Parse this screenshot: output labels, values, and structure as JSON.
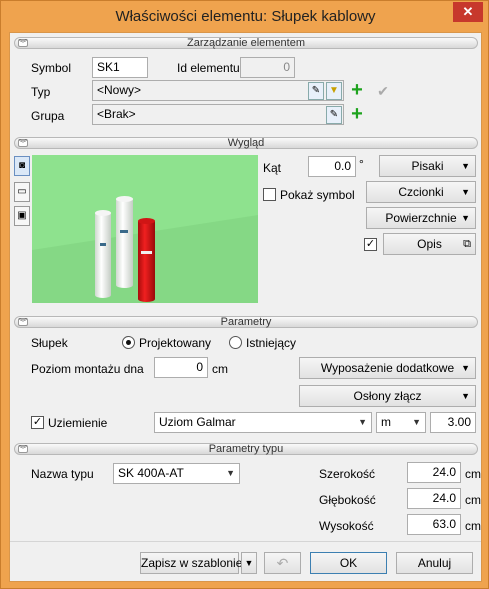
{
  "window": {
    "title": "Właściwości elementu: Słupek kablowy",
    "close_label": "✕"
  },
  "sections": {
    "management": "Zarządzanie elementem",
    "appearance": "Wygląd",
    "parameters": "Parametry",
    "type_parameters": "Parametry typu"
  },
  "management": {
    "symbol_label": "Symbol",
    "symbol_value": "SK1",
    "id_label": "Id elementu",
    "id_value": "0",
    "type_label": "Typ",
    "type_value": "<Nowy>",
    "group_label": "Grupa",
    "group_value": "<Brak>"
  },
  "appearance": {
    "angle_label": "Kąt",
    "angle_value": "0.0",
    "angle_unit": "°",
    "show_symbol_label": "Pokaż symbol",
    "show_symbol_checked": false,
    "pens_button": "Pisaki",
    "fonts_button": "Czcionki",
    "surfaces_button": "Powierzchnie",
    "description_button": "Opis",
    "description_checked": true,
    "preview_bg": "#8ee28e"
  },
  "parameters": {
    "post_label": "Słupek",
    "designed_label": "Projektowany",
    "existing_label": "Istniejący",
    "selected": "Projektowany",
    "level_label": "Poziom montażu dna",
    "level_value": "0",
    "level_unit": "cm",
    "extra_equipment_button": "Wyposażenie dodatkowe",
    "covers_button": "Osłony złącz",
    "grounding_label": "Uziemienie",
    "grounding_checked": true,
    "grounding_value": "Uziom Galmar",
    "grounding_unit": "m",
    "grounding_amount": "3.00"
  },
  "type_parameters": {
    "type_name_label": "Nazwa typu",
    "type_name_value": "SK 400A-AT",
    "width_label": "Szerokość",
    "width_value": "24.0",
    "depth_label": "Głębokość",
    "depth_value": "24.0",
    "height_label": "Wysokość",
    "height_value": "63.0",
    "unit": "cm"
  },
  "footer": {
    "save_template_button": "Zapisz w szablonie",
    "ok_button": "OK",
    "cancel_button": "Anuluj"
  }
}
